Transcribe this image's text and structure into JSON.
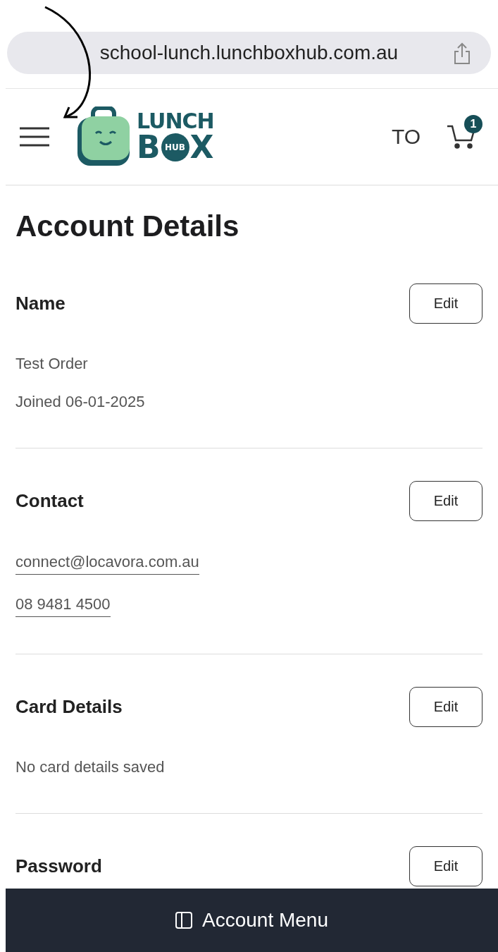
{
  "browser": {
    "url": "school-lunch.lunchboxhub.com.au"
  },
  "header": {
    "logo": {
      "top": "LUNCH",
      "bottom_left": "B",
      "badge": "HUB",
      "bottom_right": "X"
    },
    "user_initials": "TO",
    "cart_count": "1"
  },
  "page_title": "Account Details",
  "sections": [
    {
      "heading": "Name",
      "button": "Edit",
      "lines": [
        {
          "kind": "text",
          "text": "Test Order"
        },
        {
          "kind": "text",
          "text": "Joined 06-01-2025"
        }
      ]
    },
    {
      "heading": "Contact",
      "button": "Edit",
      "lines": [
        {
          "kind": "link",
          "text": "connect@locavora.com.au"
        },
        {
          "kind": "link",
          "text": "08 9481 4500"
        }
      ]
    },
    {
      "heading": "Card Details",
      "button": "Edit",
      "lines": [
        {
          "kind": "text",
          "text": "No card details saved"
        }
      ]
    },
    {
      "heading": "Password",
      "button": "Edit"
    }
  ],
  "bottom_bar": {
    "label": "Account Menu"
  }
}
